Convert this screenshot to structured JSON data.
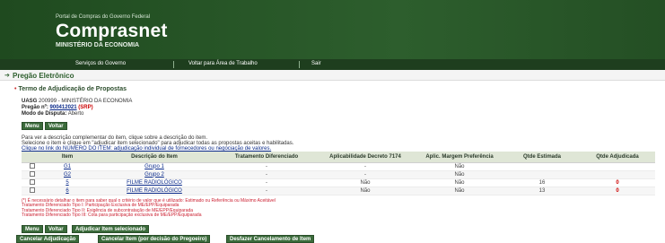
{
  "header": {
    "portal": "Portal de Compras do Governo Federal",
    "title": "Comprasnet",
    "ministry": "MINISTÉRIO DA ECONOMIA"
  },
  "nav": {
    "items": [
      "Serviços do Governo",
      "Voltar para Área de Trabalho",
      "Sair"
    ]
  },
  "section": {
    "title": "Pregão Eletrônico",
    "subtitle": "Termo de Adjudicação de Propostas"
  },
  "info": {
    "uasg_label": "UASG",
    "uasg_value": "200999 - MINISTÉRIO DA ECONOMIA",
    "pregao_label": "Pregão nº:",
    "pregao_number": "900412021",
    "pregao_suffix": "(SRP)",
    "modo_label": "Modo de Disputa:",
    "modo_value": "Aberto"
  },
  "buttons_top": {
    "menu": "Menu",
    "voltar": "Voltar"
  },
  "instructions": {
    "line1": "Para ver a descrição complementar do item, clique sobre a descrição do item.",
    "line2": "Selecione o item e clique em \"adjudicar item selecionado\" para adjudicar todas as propostas aceitas e habilitadas.",
    "line3": "Clique no link do NÚMERO DO ITEM: adjudicação individual de fornecedores ou negociação de valores."
  },
  "table": {
    "headers": [
      "",
      "Item",
      "Descrição do Item",
      "Tratamento Diferenciado",
      "Aplicabilidade Decreto 7174",
      "Aplic. Margem Preferência",
      "Qtde Estimada",
      "Qtde Adjudicada"
    ],
    "rows": [
      {
        "item": "G1",
        "desc": "Grupo 1",
        "trat": "-",
        "aplic": "-",
        "margem": "Não",
        "qtde": "",
        "adj": ""
      },
      {
        "item": "G2",
        "desc": "Grupo 2",
        "trat": "-",
        "aplic": "-",
        "margem": "Não",
        "qtde": "",
        "adj": ""
      },
      {
        "item": "5",
        "desc": "FILME RADIOLÓGICO",
        "trat": "-",
        "aplic": "Não",
        "margem": "Não",
        "qtde": "16",
        "adj": "0"
      },
      {
        "item": "6",
        "desc": "FILME RADIOLÓGICO",
        "trat": "-",
        "aplic": "Não",
        "margem": "Não",
        "qtde": "13",
        "adj": "0"
      }
    ]
  },
  "legend": [
    "(*) É necessário detalhar o item para saber qual o critério de valor que é utilizado: Estimado ou Referência ou Máximo Aceitável",
    "Tratamento Diferenciado Tipo I: Participação Exclusiva de ME/EPP/Equiparada",
    "Tratamento Diferenciado Tipo II: Exigência de subcontratação de ME/EPP/Equiparada",
    "Tratamento Diferenciado Tipo III: Cota para participação exclusiva de ME/EPP/Equiparada"
  ],
  "buttons_bottom": {
    "menu": "Menu",
    "voltar": "Voltar",
    "adjudicar": "Adjudicar Item selecionado",
    "cancelar_adj": "Cancelar Adjudicação",
    "cancelar_item": "Cancelar Item (por decisão do Pregoeiro)",
    "desfazer": "Desfazer Cancelamento de Item"
  }
}
